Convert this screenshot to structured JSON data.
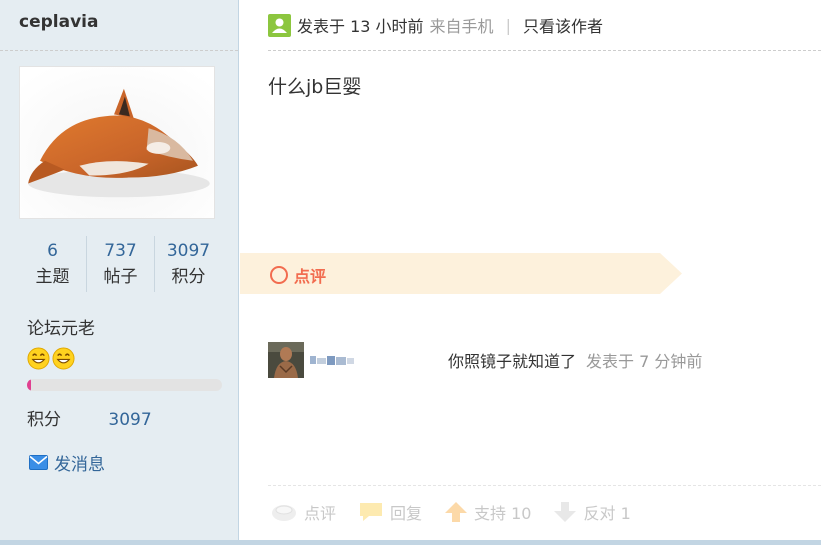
{
  "sidebar": {
    "username": "ceplavia",
    "stats": [
      {
        "value": "6",
        "label": "主题"
      },
      {
        "value": "737",
        "label": "帖子"
      },
      {
        "value": "3097",
        "label": "积分"
      }
    ],
    "rank_title": "论坛元老",
    "medals": [
      "smiley-medal-icon",
      "smiley-medal-icon"
    ],
    "progress_fraction": 0.02,
    "score_label": "积分",
    "score_value": "3097",
    "send_message_label": "发消息"
  },
  "post": {
    "posted_time": "发表于 13 小时前",
    "source": "来自手机",
    "separator": "|",
    "only_author_label": "只看该作者",
    "content": "什么jb巨婴"
  },
  "comment_section": {
    "label": "点评",
    "comments": [
      {
        "text": "你照镜子就知道了",
        "time": "发表于 7 分钟前"
      }
    ]
  },
  "actions": {
    "comment_label": "点评",
    "reply_label": "回复",
    "support_label": "支持 10",
    "oppose_label": "反对 1"
  },
  "colors": {
    "sidebar_bg": "#e5edf2",
    "link_blue": "#336699",
    "accent_orange": "#f26c4f",
    "band_bg": "#fdf1dc",
    "muted_gray": "#999999"
  }
}
